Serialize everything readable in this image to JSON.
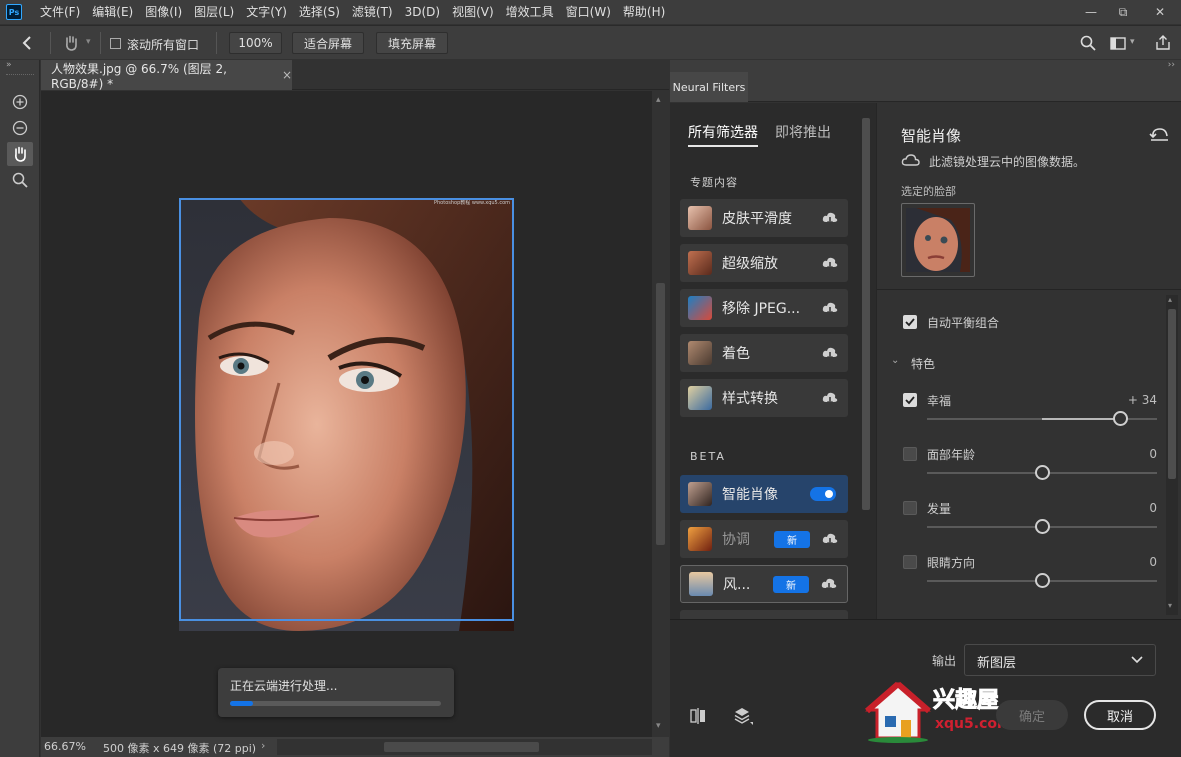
{
  "app": {
    "logo": "Ps"
  },
  "menu": [
    "文件(F)",
    "编辑(E)",
    "图像(I)",
    "图层(L)",
    "文字(Y)",
    "选择(S)",
    "滤镜(T)",
    "3D(D)",
    "视图(V)",
    "增效工具",
    "窗口(W)",
    "帮助(H)"
  ],
  "window_controls": {
    "minimize": "—",
    "restore": "⧉",
    "close": "✕"
  },
  "options_bar": {
    "scroll_all_label": "滚动所有窗口",
    "zoom_value": "100%",
    "fit_screen": "适合屏幕",
    "fill_screen": "填充屏幕"
  },
  "document": {
    "tab_title": "人物效果.jpg @ 66.7% (图层 2, RGB/8#) *",
    "close_glyph": "×",
    "image_watermark": "Photoshop教程 www.xqu5.com"
  },
  "status": {
    "zoom": "66.67%",
    "dimensions": "500 像素 x 649 像素 (72 ppi)",
    "arrow": "›"
  },
  "progress": {
    "text": "正在云端进行处理...",
    "fraction": 0.11
  },
  "panel": {
    "tab_title": "Neural Filters",
    "collapse_glyph": "››"
  },
  "filter_list": {
    "tab_all": "所有筛选器",
    "tab_upcoming": "即将推出",
    "section_featured": "专题内容",
    "featured": [
      {
        "label": "皮肤平滑度",
        "icon": "cloud-download-icon"
      },
      {
        "label": "超级缩放",
        "icon": "cloud-download-icon"
      },
      {
        "label": "移除 JPEG...",
        "icon": "cloud-download-icon"
      },
      {
        "label": "着色",
        "icon": "cloud-download-icon"
      },
      {
        "label": "样式转换",
        "icon": "cloud-download-icon"
      }
    ],
    "section_beta": "BETA",
    "beta": [
      {
        "label": "智能肖像",
        "state": "toggle-on"
      },
      {
        "label": "协调",
        "badge": "新"
      },
      {
        "label": "风...",
        "badge": "新"
      }
    ]
  },
  "settings": {
    "title": "智能肖像",
    "cloud_note": "此滤镜处理云中的图像数据。",
    "selected_face_label": "选定的脸部",
    "auto_balance": {
      "label": "自动平衡组合",
      "checked": true
    },
    "section_features": "特色",
    "sliders": [
      {
        "label": "幸福",
        "checked": true,
        "value_text": "+ 34",
        "value": 34,
        "min": -50,
        "max": 50
      },
      {
        "label": "面部年龄",
        "checked": false,
        "value_text": "0",
        "value": 0,
        "min": -50,
        "max": 50
      },
      {
        "label": "发量",
        "checked": false,
        "value_text": "0",
        "value": 0,
        "min": -50,
        "max": 50
      },
      {
        "label": "眼睛方向",
        "checked": false,
        "value_text": "0",
        "value": 0,
        "min": -50,
        "max": 50
      }
    ]
  },
  "bottom": {
    "output_label": "输出",
    "output_value": "新图层",
    "ok_label": "确定",
    "cancel_label": "取消",
    "watermark_text": "兴趣屋",
    "watermark_url": "xqu5.com"
  },
  "colors": {
    "accent": "#1473e6",
    "selection_border": "#4a90e2"
  }
}
